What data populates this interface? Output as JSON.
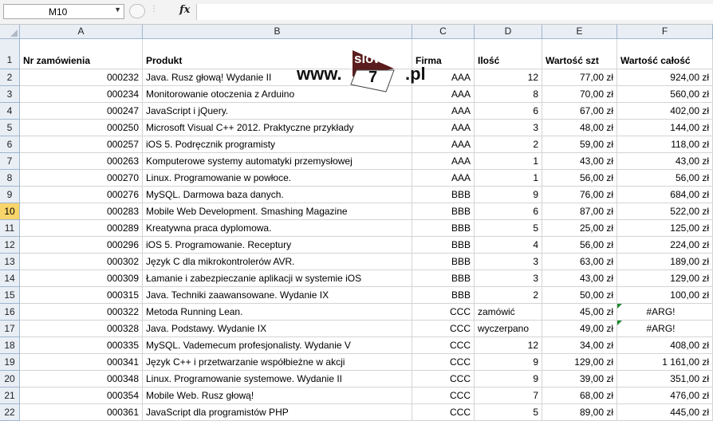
{
  "formula_bar": {
    "name_box": "M10",
    "fx_label": "fx",
    "formula": ""
  },
  "columns": [
    "A",
    "B",
    "C",
    "D",
    "E",
    "F"
  ],
  "header_row": {
    "number": "1",
    "cells": [
      "Nr zamówienia",
      "Produkt",
      "Firma",
      "Ilość",
      "Wartość szt",
      "Wartość całość"
    ]
  },
  "selected_row": "10",
  "rows": [
    {
      "n": "2",
      "a": "000232",
      "b": "Java. Rusz głową! Wydanie II",
      "c": "AAA",
      "d": "12",
      "e": "77,00 zł",
      "f": "924,00 zł"
    },
    {
      "n": "3",
      "a": "000234",
      "b": "Monitorowanie otoczenia z Arduino",
      "c": "AAA",
      "d": "8",
      "e": "70,00 zł",
      "f": "560,00 zł"
    },
    {
      "n": "4",
      "a": "000247",
      "b": "JavaScript i jQuery.",
      "c": "AAA",
      "d": "6",
      "e": "67,00 zł",
      "f": "402,00 zł"
    },
    {
      "n": "5",
      "a": "000250",
      "b": "Microsoft Visual C++ 2012. Praktyczne przykłady",
      "c": "AAA",
      "d": "3",
      "e": "48,00 zł",
      "f": "144,00 zł"
    },
    {
      "n": "6",
      "a": "000257",
      "b": "iOS 5. Podręcznik programisty",
      "c": "AAA",
      "d": "2",
      "e": "59,00 zł",
      "f": "118,00 zł"
    },
    {
      "n": "7",
      "a": "000263",
      "b": "Komputerowe systemy automatyki przemysłowej",
      "c": "AAA",
      "d": "1",
      "e": "43,00 zł",
      "f": "43,00 zł"
    },
    {
      "n": "8",
      "a": "000270",
      "b": "Linux. Programowanie w powłoce.",
      "c": "AAA",
      "d": "1",
      "e": "56,00 zł",
      "f": "56,00 zł"
    },
    {
      "n": "9",
      "a": "000276",
      "b": "MySQL. Darmowa baza danych.",
      "c": "BBB",
      "d": "9",
      "e": "76,00 zł",
      "f": "684,00 zł"
    },
    {
      "n": "10",
      "a": "000283",
      "b": "Mobile Web Development. Smashing Magazine",
      "c": "BBB",
      "d": "6",
      "e": "87,00 zł",
      "f": "522,00 zł"
    },
    {
      "n": "11",
      "a": "000289",
      "b": "Kreatywna praca dyplomowa.",
      "c": "BBB",
      "d": "5",
      "e": "25,00 zł",
      "f": "125,00 zł"
    },
    {
      "n": "12",
      "a": "000296",
      "b": "iOS 5. Programowanie. Receptury",
      "c": "BBB",
      "d": "4",
      "e": "56,00 zł",
      "f": "224,00 zł"
    },
    {
      "n": "13",
      "a": "000302",
      "b": "Język C dla mikrokontrolerów AVR.",
      "c": "BBB",
      "d": "3",
      "e": "63,00 zł",
      "f": "189,00 zł"
    },
    {
      "n": "14",
      "a": "000309",
      "b": "Łamanie i zabezpieczanie aplikacji w systemie iOS",
      "c": "BBB",
      "d": "3",
      "e": "43,00 zł",
      "f": "129,00 zł"
    },
    {
      "n": "15",
      "a": "000315",
      "b": "Java. Techniki zaawansowane. Wydanie IX",
      "c": "BBB",
      "d": "2",
      "e": "50,00 zł",
      "f": "100,00 zł"
    },
    {
      "n": "16",
      "a": "000322",
      "b": "Metoda Running Lean.",
      "c": "CCC",
      "d": "zamówić",
      "e": "45,00 zł",
      "f": "#ARG!",
      "dtext": true,
      "ferr": true
    },
    {
      "n": "17",
      "a": "000328",
      "b": "Java. Podstawy. Wydanie IX",
      "c": "CCC",
      "d": "wyczerpano",
      "e": "49,00 zł",
      "f": "#ARG!",
      "dtext": true,
      "ferr": true
    },
    {
      "n": "18",
      "a": "000335",
      "b": "MySQL. Vademecum profesjonalisty. Wydanie V",
      "c": "CCC",
      "d": "12",
      "e": "34,00 zł",
      "f": "408,00 zł"
    },
    {
      "n": "19",
      "a": "000341",
      "b": "Język C++ i przetwarzanie współbieżne w akcji",
      "c": "CCC",
      "d": "9",
      "e": "129,00 zł",
      "f": "1 161,00 zł"
    },
    {
      "n": "20",
      "a": "000348",
      "b": "Linux. Programowanie systemowe. Wydanie II",
      "c": "CCC",
      "d": "9",
      "e": "39,00 zł",
      "f": "351,00 zł"
    },
    {
      "n": "21",
      "a": "000354",
      "b": "Mobile Web. Rusz głową!",
      "c": "CCC",
      "d": "7",
      "e": "68,00 zł",
      "f": "476,00 zł"
    },
    {
      "n": "22",
      "a": "000361",
      "b": "JavaScript dla programistów PHP",
      "c": "CCC",
      "d": "5",
      "e": "89,00 zł",
      "f": "445,00 zł"
    }
  ],
  "watermark": {
    "prefix": "www.",
    "word": "slow",
    "digit": "7",
    "suffix": ".pl"
  }
}
